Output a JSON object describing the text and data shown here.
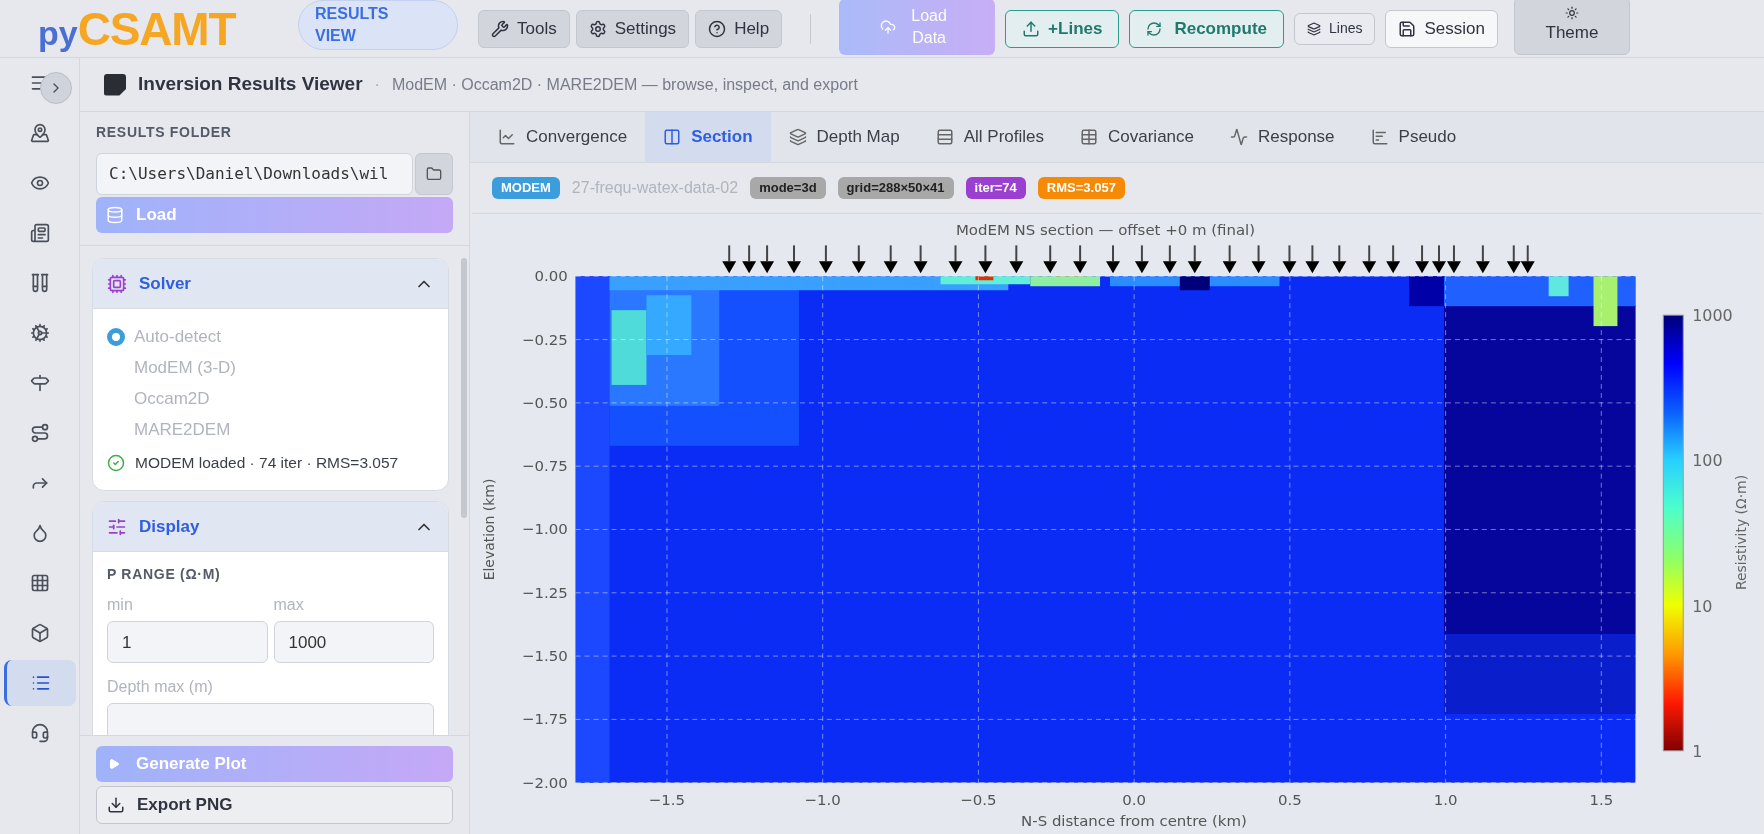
{
  "logo": {
    "prefix": "py",
    "name": "CSAMT"
  },
  "view_pill": {
    "label": "RESULTS VIEW"
  },
  "toolbar": [
    {
      "kind": "tools",
      "label": "Tools"
    },
    {
      "kind": "settings",
      "label": "Settings"
    },
    {
      "kind": "help",
      "label": "Help"
    }
  ],
  "actions": [
    {
      "kind": "load",
      "label": "Load Data",
      "disabled": true
    },
    {
      "kind": "lines_add",
      "label": "+Lines"
    },
    {
      "kind": "recompute",
      "label": "Recompute"
    },
    {
      "kind": "lines",
      "label": "Lines"
    },
    {
      "kind": "session",
      "label": "Session"
    },
    {
      "kind": "theme",
      "label": "Theme"
    }
  ],
  "page_header": {
    "title": "Inversion Results Viewer",
    "separator": "·",
    "subtitle": "ModEM · Occam2D · MARE2DEM — browse, inspect, and export"
  },
  "rail": [
    {
      "selected": false
    },
    {
      "selected": false
    },
    {
      "selected": false
    },
    {
      "selected": false
    },
    {
      "selected": false
    },
    {
      "selected": false
    },
    {
      "selected": false
    },
    {
      "selected": false
    },
    {
      "selected": false
    },
    {
      "selected": false
    },
    {
      "selected": false
    },
    {
      "selected": false
    },
    {
      "selected": true
    },
    {
      "selected": false
    }
  ],
  "results_folder": {
    "label": "RESULTS FOLDER",
    "path": "C:\\Users\\Daniel\\Downloads\\wil",
    "load_button": "Load"
  },
  "solver": {
    "title": "Solver",
    "expanded": true,
    "options": [
      {
        "label": "Auto-detect",
        "selected": true
      },
      {
        "label": "ModEM (3-D)",
        "selected": false
      },
      {
        "label": "Occam2D",
        "selected": false
      },
      {
        "label": "MARE2DEM",
        "selected": false
      }
    ],
    "status": "MODEM loaded · 74 iter · RMS=3.057"
  },
  "display": {
    "title": "Display",
    "expanded": true,
    "range_label": "P RANGE (Ω·M)",
    "min_label": "min",
    "min_value": "1",
    "max_label": "max",
    "max_value": "1000",
    "depth_label": "Depth max (m)"
  },
  "bottom_buttons": {
    "generate": "Generate Plot",
    "export": "Export PNG"
  },
  "tabs": [
    {
      "kind": "convergence",
      "label": "Convergence",
      "selected": false
    },
    {
      "kind": "section",
      "label": "Section",
      "selected": true
    },
    {
      "kind": "depth",
      "label": "Depth Map",
      "selected": false
    },
    {
      "kind": "profiles",
      "label": "All Profiles",
      "selected": false
    },
    {
      "kind": "covariance",
      "label": "Covariance",
      "selected": false
    },
    {
      "kind": "response",
      "label": "Response",
      "selected": false
    },
    {
      "kind": "pseudo",
      "label": "Pseudo",
      "selected": false
    }
  ],
  "badges": [
    {
      "kind": "badge",
      "label": "MODEM",
      "color": "#3b9ddb"
    },
    {
      "kind": "text",
      "label": "27-frequ-watex-data-02"
    },
    {
      "kind": "badge",
      "label": "mode=3d",
      "color": "#a8a8a8"
    },
    {
      "kind": "badge",
      "label": "grid=288×50×41",
      "color": "#a8a8a8"
    },
    {
      "kind": "badge",
      "label": "iter=74",
      "color": "#9b3fd1"
    },
    {
      "kind": "badge",
      "label": "RMS=3.057",
      "color": "#f58a07"
    }
  ],
  "plot": {
    "title": "ModEM NS section — offset +0 m (final)",
    "xlabel": "N-S distance from centre (km)",
    "ylabel": "Elevation (km)",
    "xticks": [
      "−1.5",
      "−1.0",
      "−0.5",
      "0.0",
      "0.5",
      "1.0",
      "1.5"
    ],
    "yticks": [
      "0.00",
      "−0.25",
      "−0.50",
      "−0.75",
      "−1.00",
      "−1.25",
      "−1.50",
      "−1.75",
      "−2.00"
    ],
    "colorbar": {
      "label": "Resistivity (Ω·m)",
      "ticks": [
        "1000",
        "100",
        "10",
        "1"
      ]
    }
  }
}
